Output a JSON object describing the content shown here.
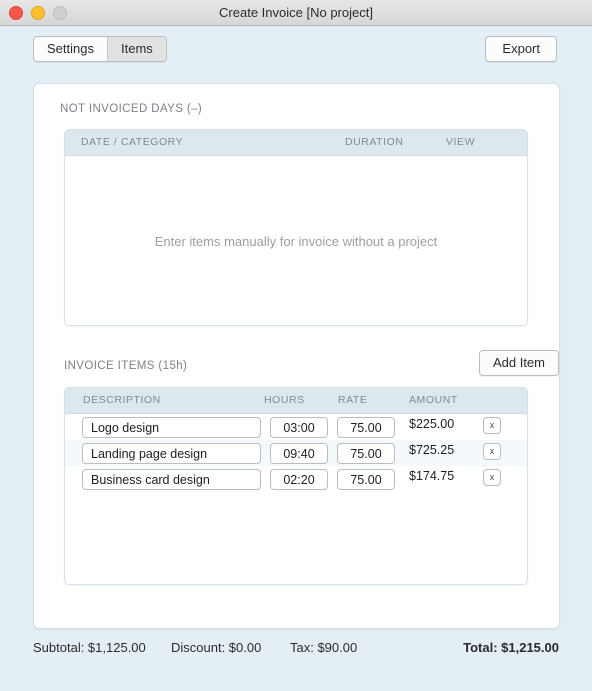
{
  "window": {
    "title": "Create Invoice [No project]",
    "controls": {
      "close": "close-button",
      "minimize": "minimize-button",
      "zoom": "zoom-button"
    }
  },
  "toolbar": {
    "tabs": [
      {
        "label": "Settings",
        "active": false
      },
      {
        "label": "Items",
        "active": true
      }
    ],
    "export_label": "Export"
  },
  "not_invoiced": {
    "section_label": "NOT INVOICED DAYS (–)",
    "columns": [
      "DATE / CATEGORY",
      "DURATION",
      "VIEW"
    ],
    "empty_message": "Enter items manually for invoice without a project",
    "rows": []
  },
  "invoice_items": {
    "section_label": "INVOICE ITEMS (15h)",
    "add_item_label": "Add Item",
    "columns": [
      "DESCRIPTION",
      "HOURS",
      "RATE",
      "AMOUNT"
    ],
    "delete_label": "x",
    "rows": [
      {
        "description": "Logo design",
        "hours": "03:00",
        "rate": "75.00",
        "amount": "$225.00"
      },
      {
        "description": "Landing page design",
        "hours": "09:40",
        "rate": "75.00",
        "amount": "$725.25"
      },
      {
        "description": "Business card design",
        "hours": "02:20",
        "rate": "75.00",
        "amount": "$174.75"
      }
    ]
  },
  "footer": {
    "subtotal": "Subtotal: $1,125.00",
    "discount": "Discount: $0.00",
    "tax": "Tax: $90.00",
    "total": "Total: $1,215.00"
  },
  "colors": {
    "window_background": "#e4eff5",
    "card_background": "#ffffff",
    "table_header": "#dce7ee",
    "alt_row": "#f4f9fb",
    "label_text": "#7b8288",
    "close": "#f7564a",
    "minimize": "#febf2e",
    "zoom": "#cfcfcf"
  }
}
